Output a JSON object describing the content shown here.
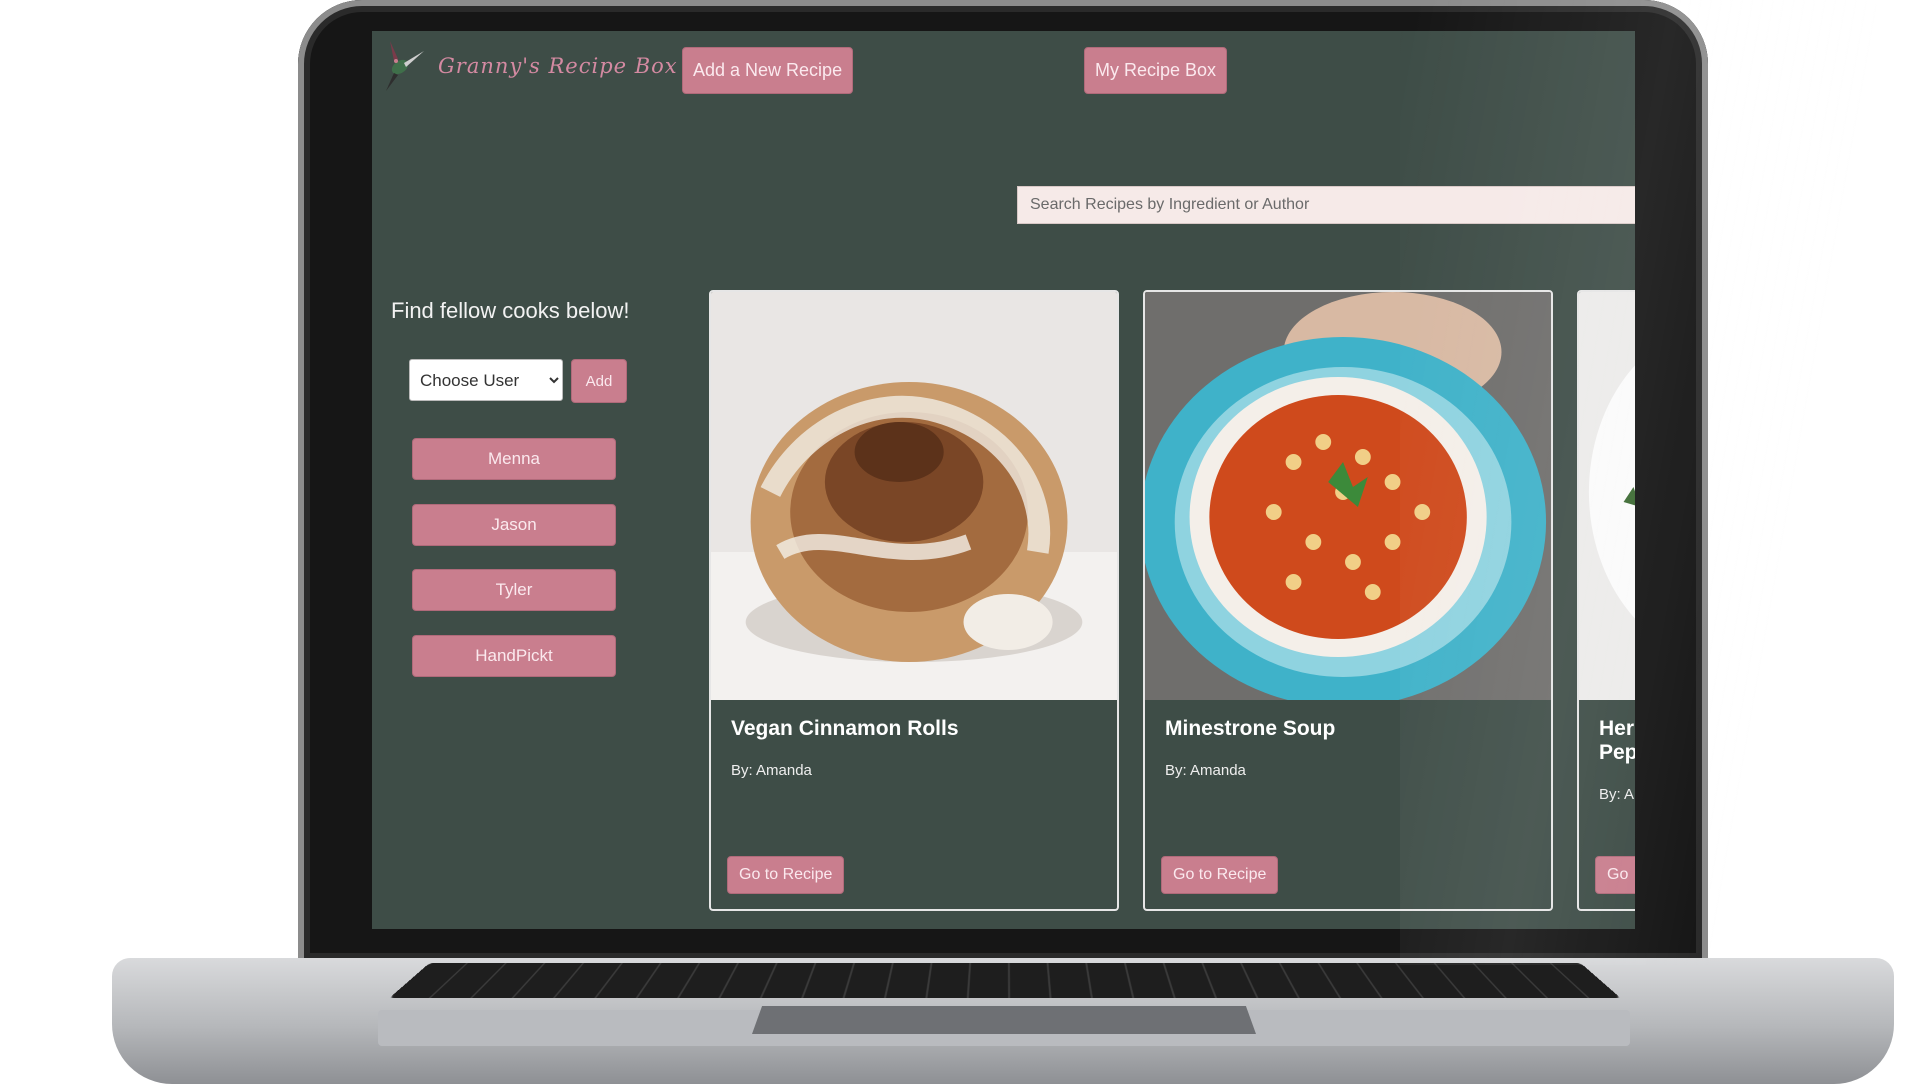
{
  "app": {
    "title": "Granny's Recipe Box"
  },
  "nav": {
    "add_recipe": "Add a New Recipe",
    "my_box": "My Recipe Box"
  },
  "search": {
    "placeholder": "Search Recipes by Ingredient or Author"
  },
  "sidebar": {
    "heading": "Find fellow cooks below!",
    "select_label": "Choose User",
    "add_label": "Add",
    "users": [
      "Menna",
      "Jason",
      "Tyler",
      "HandPickt"
    ]
  },
  "recipes": [
    {
      "title": "Vegan Cinnamon Rolls",
      "author": "By: Amanda",
      "button": "Go to Recipe",
      "image": "cinnamon-roll-image"
    },
    {
      "title": "Minestrone Soup",
      "author": "By: Amanda",
      "button": "Go to Recipe",
      "image": "soup-bowl-image"
    },
    {
      "title": "Herl Pepi",
      "author": "By: A",
      "button": "Go",
      "image": "plate-image"
    }
  ],
  "colors": {
    "background": "#3e4d47",
    "accent": "#c97e8e",
    "logo": "#d48aa2"
  }
}
